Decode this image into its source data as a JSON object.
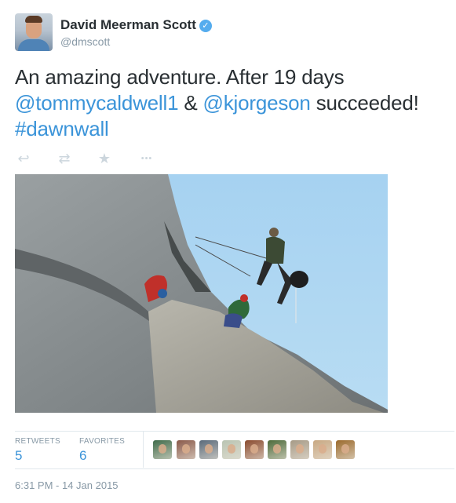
{
  "author": {
    "name": "David Meerman Scott",
    "handle": "@dmscott",
    "verified_glyph": "✓"
  },
  "tweet": {
    "line1": "An amazing adventure. After 19 days",
    "mention1": "@tommycaldwell1",
    "amp": " & ",
    "mention2": "@kjorgeson",
    "line2_rest": " succeeded!",
    "hashtag": "#dawnwall"
  },
  "actions": [
    {
      "name": "reply-icon",
      "glyph": "↩"
    },
    {
      "name": "retweet-icon",
      "glyph": "⇄"
    },
    {
      "name": "favorite-star-icon",
      "glyph": "★"
    },
    {
      "name": "more-options-icon",
      "glyph": "•••"
    }
  ],
  "stats": {
    "retweets_label": "RETWEETS",
    "retweets_value": "5",
    "favorites_label": "FAVORITES",
    "favorites_value": "6"
  },
  "favoriters": [
    {
      "name": "favoriter-avatar-1",
      "color": "#3f6b4a"
    },
    {
      "name": "favoriter-avatar-2",
      "color": "#8a5a4a"
    },
    {
      "name": "favoriter-avatar-3",
      "color": "#5a6a7a"
    },
    {
      "name": "favoriter-avatar-4",
      "color": "#b9c4b2"
    },
    {
      "name": "favoriter-avatar-5",
      "color": "#8a4b2e"
    },
    {
      "name": "favoriter-avatar-6",
      "color": "#4d6b3a"
    },
    {
      "name": "favoriter-avatar-7",
      "color": "#a69a86"
    },
    {
      "name": "favoriter-avatar-8",
      "color": "#c8a882"
    },
    {
      "name": "favoriter-avatar-9",
      "color": "#9b6a2c"
    }
  ],
  "timestamp": "6:31 PM - 14 Jan 2015",
  "colors": {
    "link": "#3b94d9",
    "text": "#292f33",
    "muted": "#8899a6",
    "icon": "#ccd6dd"
  }
}
